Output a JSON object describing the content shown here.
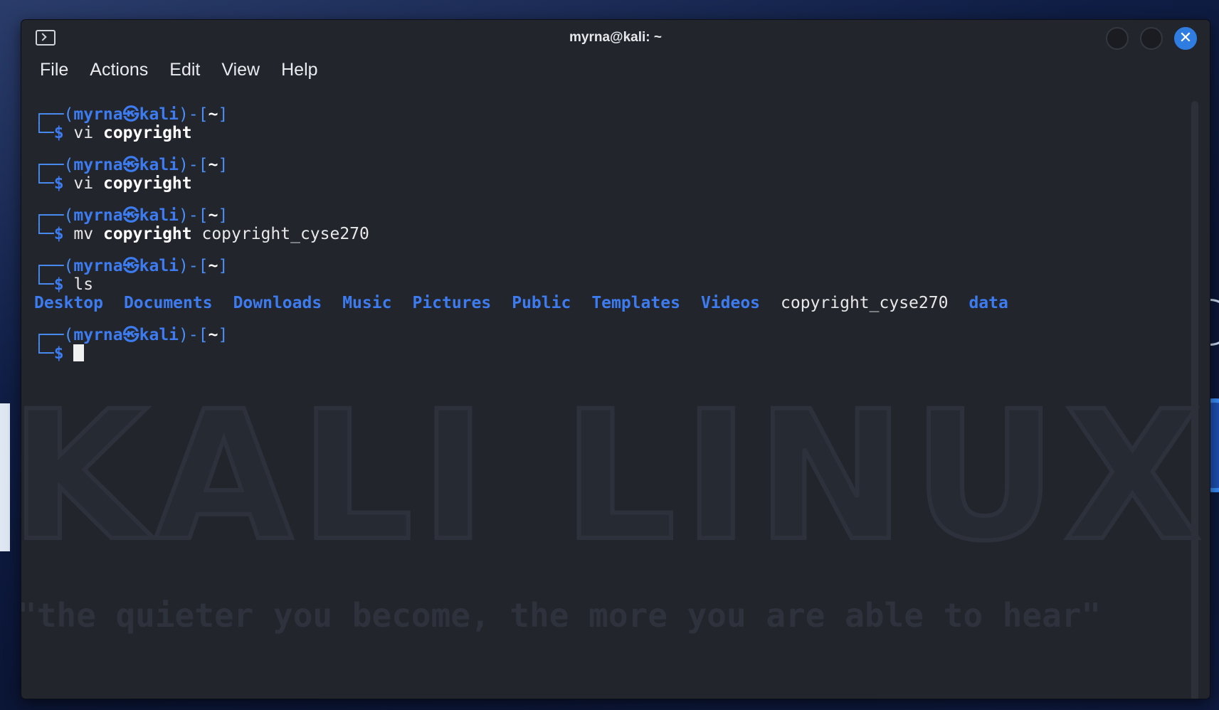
{
  "window": {
    "title": "myrna@kali: ~"
  },
  "menu": [
    "File",
    "Actions",
    "Edit",
    "View",
    "Help"
  ],
  "prompt": {
    "user": "myrna",
    "at_symbol": "㉿",
    "host": "kali",
    "dir": "~",
    "dollar": "$"
  },
  "history": [
    {
      "cmd": "vi",
      "arg": "copyright",
      "arg2": ""
    },
    {
      "cmd": "vi",
      "arg": "copyright",
      "arg2": ""
    },
    {
      "cmd": "mv",
      "arg": "copyright",
      "arg2": "copyright_cyse270"
    },
    {
      "cmd": "ls",
      "arg": "",
      "arg2": ""
    }
  ],
  "ls_output": [
    {
      "name": "Desktop",
      "type": "dir"
    },
    {
      "name": "Documents",
      "type": "dir"
    },
    {
      "name": "Downloads",
      "type": "dir"
    },
    {
      "name": "Music",
      "type": "dir"
    },
    {
      "name": "Pictures",
      "type": "dir"
    },
    {
      "name": "Public",
      "type": "dir"
    },
    {
      "name": "Templates",
      "type": "dir"
    },
    {
      "name": "Videos",
      "type": "dir"
    },
    {
      "name": "copyright_cyse270",
      "type": "file"
    },
    {
      "name": "data",
      "type": "dir"
    }
  ],
  "wallpaper": {
    "watermark": "KALI LINUX",
    "quote": "\"the quieter you become, the more you are able to hear\""
  },
  "colors": {
    "accent": "#3d7cf0",
    "terminal_bg": "#23252d",
    "close_button": "#2f7de1"
  }
}
